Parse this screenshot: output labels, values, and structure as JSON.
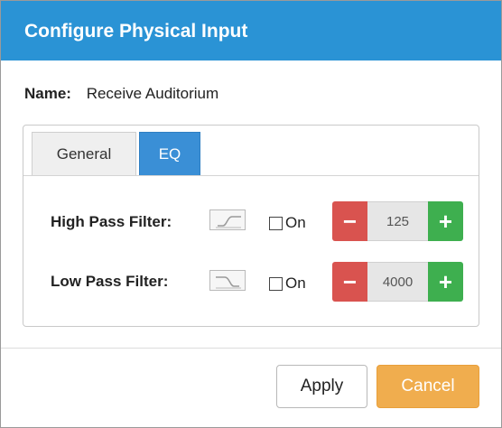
{
  "dialog": {
    "title": "Configure Physical Input",
    "name_label": "Name:",
    "name_value": "Receive Auditorium"
  },
  "tabs": [
    {
      "label": "General",
      "active": false
    },
    {
      "label": "EQ",
      "active": true
    }
  ],
  "filters": [
    {
      "label": "High Pass Filter:",
      "icon": "high-pass-curve-icon",
      "checkbox_label": "On",
      "checked": false,
      "minus_symbol": "−",
      "value": "125",
      "plus_symbol": "+"
    },
    {
      "label": "Low Pass Filter:",
      "icon": "low-pass-curve-icon",
      "checkbox_label": "On",
      "checked": false,
      "minus_symbol": "−",
      "value": "4000",
      "plus_symbol": "+"
    }
  ],
  "footer": {
    "apply_label": "Apply",
    "cancel_label": "Cancel"
  },
  "colors": {
    "titlebar": "#2a93d5",
    "active_tab": "#3a8fd6",
    "minus_button": "#d9534f",
    "plus_button": "#3eaf4f",
    "cancel_button": "#f0ad4e"
  }
}
